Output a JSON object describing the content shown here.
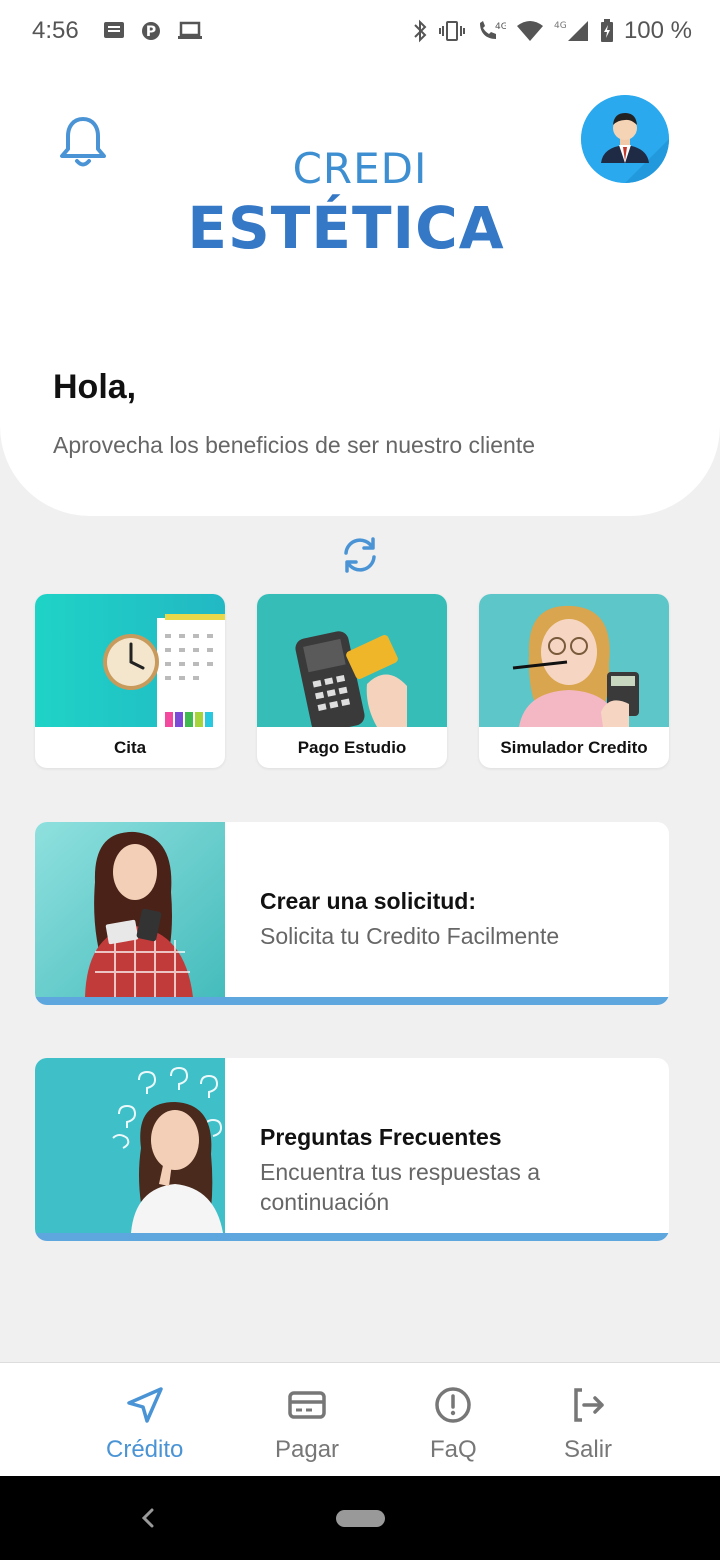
{
  "status_bar": {
    "time": "4:56",
    "battery": "100 %",
    "network_1": "4G",
    "network_2": "4G"
  },
  "header": {
    "logo_top": "CREDI",
    "logo_main": "ESTÉTICA",
    "greeting": "Hola,",
    "subtitle": "Aprovecha los beneficios de ser nuestro cliente"
  },
  "tiles": [
    {
      "label": "Cita"
    },
    {
      "label": "Pago Estudio"
    },
    {
      "label": "Simulador Credito"
    }
  ],
  "cards": [
    {
      "title": "Crear una solicitud:",
      "text": "Solicita tu Credito Facilmente"
    },
    {
      "title": "Preguntas Frecuentes",
      "text": "Encuentra tus respuestas a continuación"
    }
  ],
  "nav": [
    {
      "label": "Crédito",
      "icon": "send-icon",
      "active": true
    },
    {
      "label": "Pagar",
      "icon": "card-icon",
      "active": false
    },
    {
      "label": "FaQ",
      "icon": "alert-circle-icon",
      "active": false
    },
    {
      "label": "Salir",
      "icon": "logout-icon",
      "active": false
    }
  ],
  "colors": {
    "accent": "#4a94d6",
    "logo_blue": "#3478c6",
    "teal": "#3fc1c9"
  }
}
